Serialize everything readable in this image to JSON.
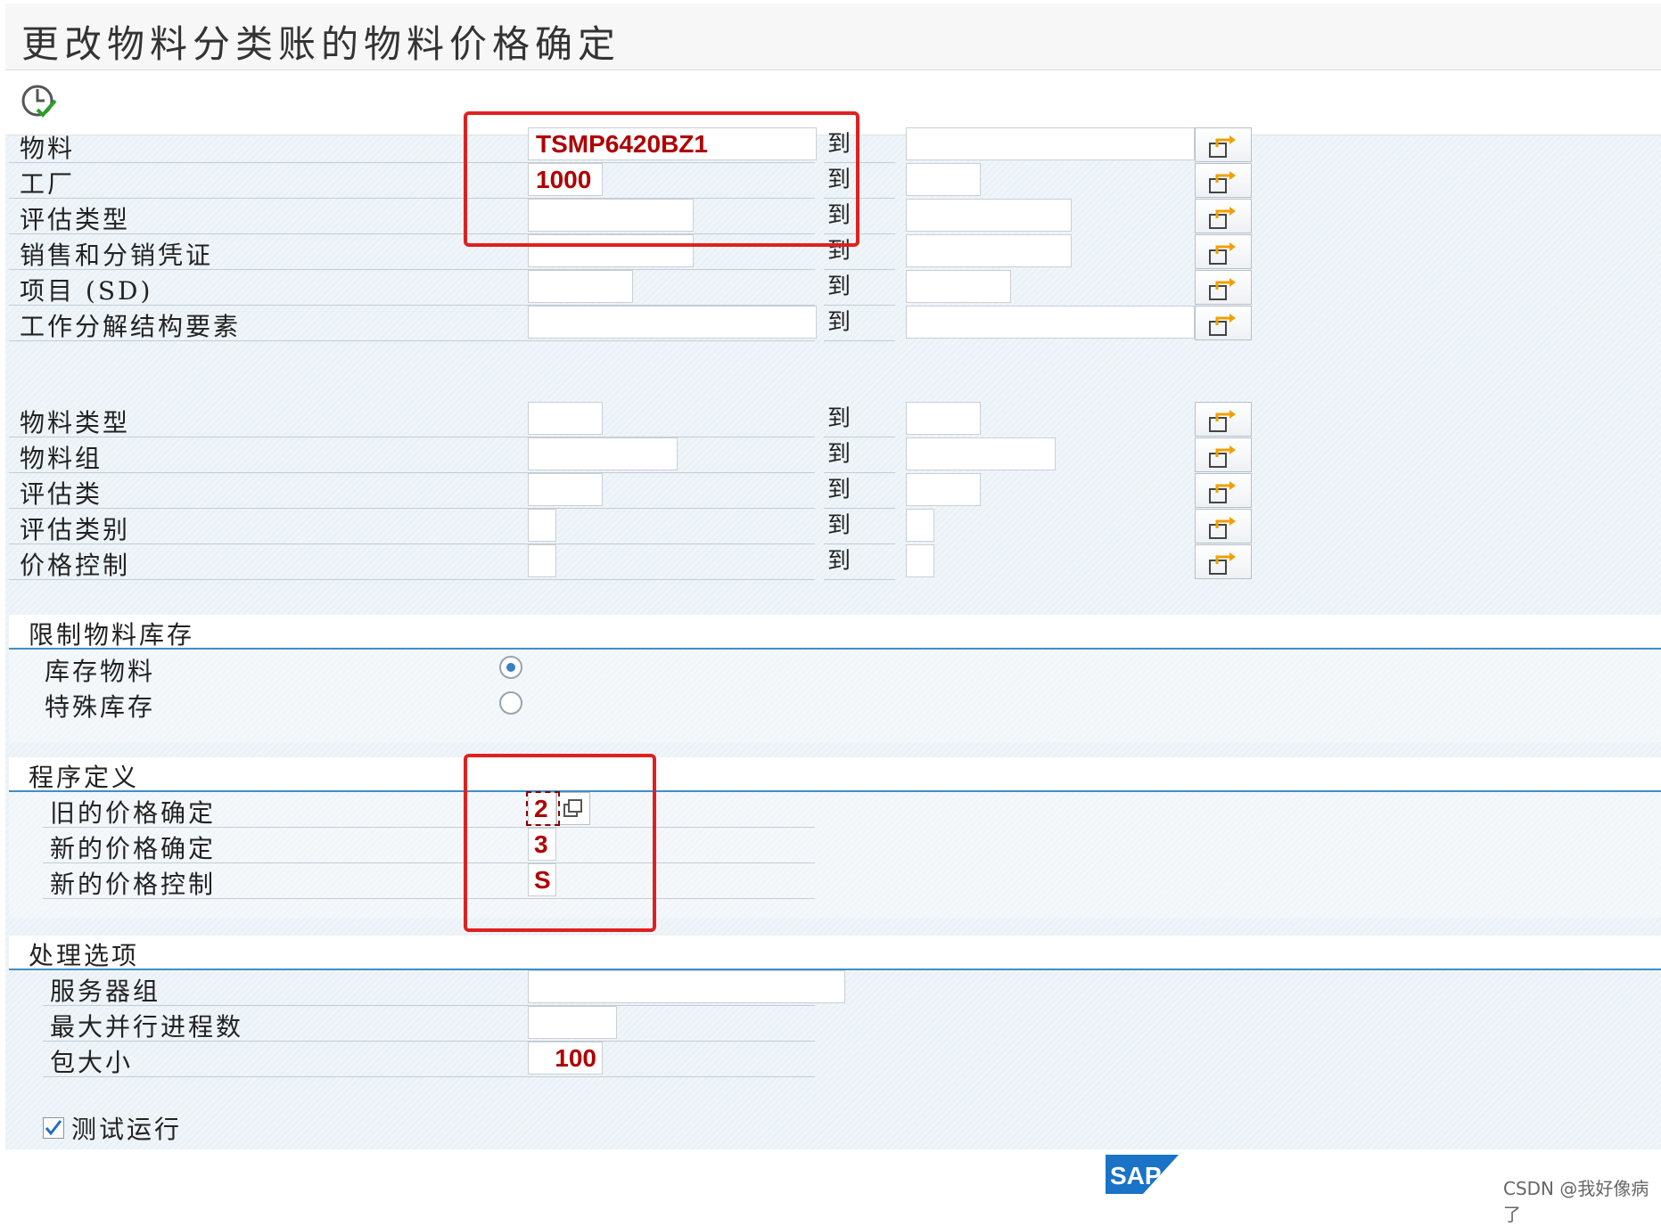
{
  "window": {
    "title": "更改物料分类账的物料价格确定"
  },
  "toolbar": {
    "execute_icon": "execute-icon"
  },
  "selection": {
    "to_label": "到",
    "rows": [
      {
        "label": "物料",
        "from": "TSMP6420BZ1",
        "to": ""
      },
      {
        "label": "工厂",
        "from": "1000",
        "to": ""
      },
      {
        "label": "评估类型",
        "from": "",
        "to": ""
      },
      {
        "label": "销售和分销凭证",
        "from": "",
        "to": ""
      },
      {
        "label": "项目 (SD)",
        "from": "",
        "to": ""
      },
      {
        "label": "工作分解结构要素",
        "from": "",
        "to": ""
      },
      {
        "label": "物料类型",
        "from": "",
        "to": ""
      },
      {
        "label": "物料组",
        "from": "",
        "to": ""
      },
      {
        "label": "评估类",
        "from": "",
        "to": ""
      },
      {
        "label": "评估类别",
        "from": "",
        "to": ""
      },
      {
        "label": "价格控制",
        "from": "",
        "to": ""
      }
    ]
  },
  "restrict_stock": {
    "title": "限制物料库存",
    "options": [
      {
        "label": "库存物料",
        "selected": true
      },
      {
        "label": "特殊库存",
        "selected": false
      }
    ]
  },
  "program_def": {
    "title": "程序定义",
    "rows": [
      {
        "label": "旧的价格确定",
        "value": "2"
      },
      {
        "label": "新的价格确定",
        "value": "3"
      },
      {
        "label": "新的价格控制",
        "value": "S"
      }
    ]
  },
  "processing": {
    "title": "处理选项",
    "rows": [
      {
        "label": "服务器组",
        "value": ""
      },
      {
        "label": "最大并行进程数",
        "value": ""
      },
      {
        "label": "包大小",
        "value": "100"
      }
    ]
  },
  "test_run": {
    "label": "测试运行",
    "checked": true
  },
  "footer": {
    "logo": "SAP",
    "watermark": "CSDN @我好像病了"
  },
  "colors": {
    "value_red": "#b00000",
    "annotation_red": "#e02020",
    "section_line": "#3f8fc7",
    "accent_orange": "#f0a000"
  }
}
